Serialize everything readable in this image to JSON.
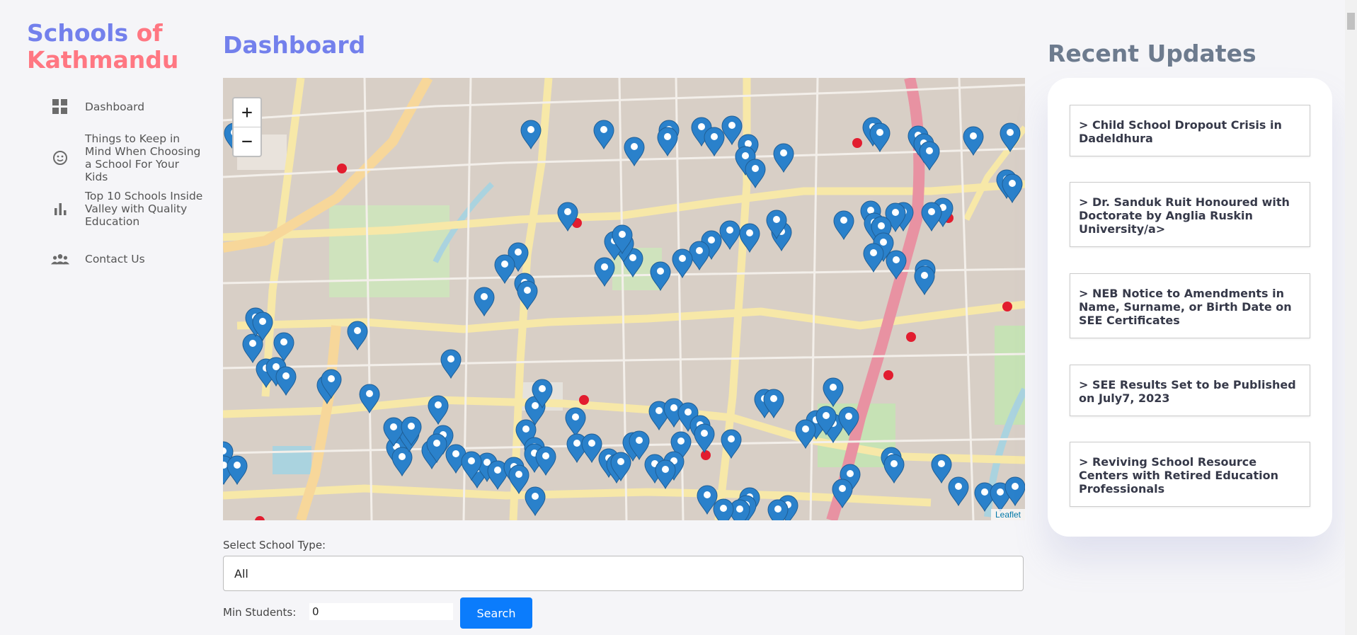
{
  "brand": {
    "word1": "Schools",
    "word2": "of",
    "word3": "Kathmandu"
  },
  "nav": [
    {
      "label": "Dashboard",
      "icon": "grid-icon"
    },
    {
      "label": "Things to Keep in Mind When Choosing a School For Your Kids",
      "icon": "smiley-icon"
    },
    {
      "label": "Top 10 Schools Inside Valley with Quality Education",
      "icon": "bar-chart-icon"
    },
    {
      "label": "Contact Us",
      "icon": "people-icon"
    }
  ],
  "main": {
    "title": "Dashboard",
    "map": {
      "zoom_in": "+",
      "zoom_out": "−",
      "attribution": "Leaflet"
    },
    "filter": {
      "type_label": "Select School Type:",
      "type_value": "All",
      "min_label": "Min Students:",
      "min_value": "0",
      "search_label": "Search"
    }
  },
  "updates": {
    "title": "Recent Updates",
    "items": [
      "> Child School Dropout Crisis in Dadeldhura",
      "> Dr. Sanduk Ruit Honoured with Doctorate by Anglia Ruskin University/a>",
      "> NEB Notice to Amendments in Name, Surname, or Birth Date on SEE Certificates",
      "> SEE Results Set to be Published on July7, 2023",
      "> Reviving School Resource Centers with Retired Education Professionals"
    ]
  },
  "colors": {
    "primary": "#7380ec",
    "danger": "#ff7782",
    "button": "#0b7cfc",
    "marker": "#2a81cb"
  }
}
